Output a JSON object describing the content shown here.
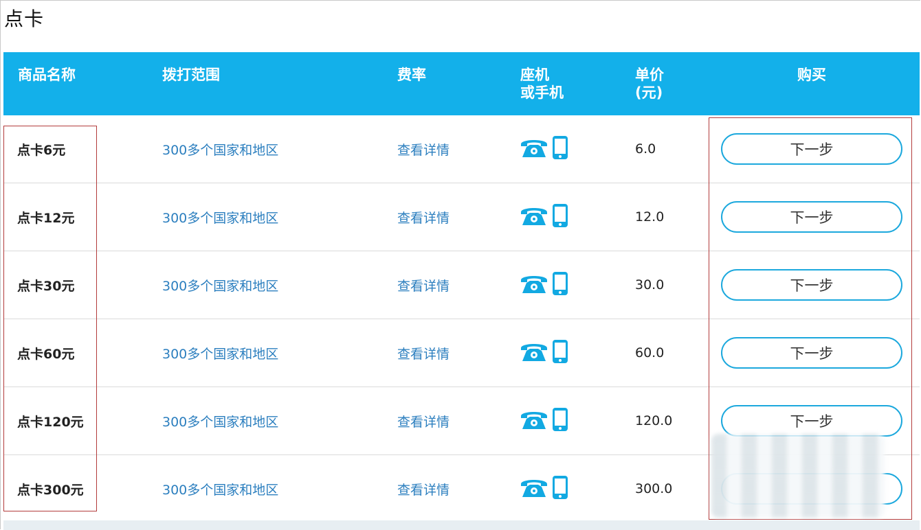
{
  "page": {
    "title": "点卡"
  },
  "table": {
    "headers": {
      "name": "商品名称",
      "range": "拨打范围",
      "rate": "费率",
      "device_line1": "座机",
      "device_line2": "或手机",
      "price_line1": "单价",
      "price_line2": "(元)",
      "buy": "购买"
    },
    "rows": [
      {
        "name": "点卡6元",
        "range": "300多个国家和地区",
        "rate": "查看详情",
        "price": "6.0",
        "buy": "下一步"
      },
      {
        "name": "点卡12元",
        "range": "300多个国家和地区",
        "rate": "查看详情",
        "price": "12.0",
        "buy": "下一步"
      },
      {
        "name": "点卡30元",
        "range": "300多个国家和地区",
        "rate": "查看详情",
        "price": "30.0",
        "buy": "下一步"
      },
      {
        "name": "点卡60元",
        "range": "300多个国家和地区",
        "rate": "查看详情",
        "price": "60.0",
        "buy": "下一步"
      },
      {
        "name": "点卡120元",
        "range": "300多个国家和地区",
        "rate": "查看详情",
        "price": "120.0",
        "buy": "下一步"
      },
      {
        "name": "点卡300元",
        "range": "300多个国家和地区",
        "rate": "查看详情",
        "price": "300.0",
        "buy": ""
      }
    ],
    "icons": {
      "landline": "telephone-icon",
      "mobile": "mobile-phone-icon"
    }
  },
  "colors": {
    "header_bg": "#13b0ea",
    "link": "#2c7fbf",
    "button_border": "#1ba8dd",
    "highlight": "#b23a3a"
  }
}
